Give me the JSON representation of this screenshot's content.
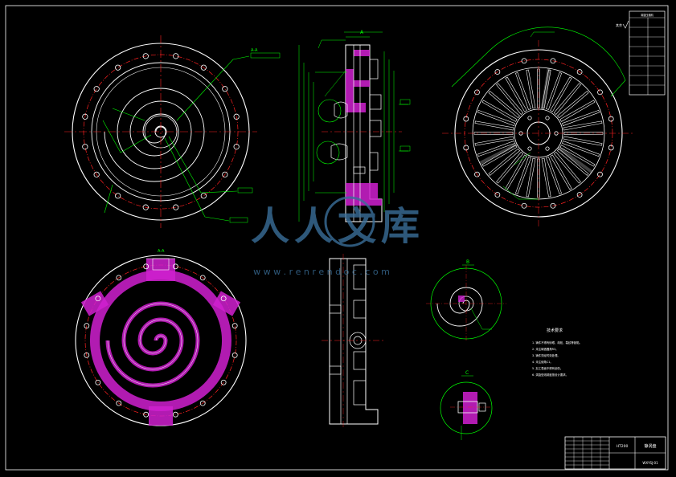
{
  "colors": {
    "background": "#000000",
    "outline": "#ffffff",
    "centerline": "#ff2020",
    "dimension": "#00ff00",
    "hatch": "#d020d0",
    "watermark": "#3a6f99"
  },
  "section_labels": {
    "top_left_view": "A-A",
    "side_view_top": "A",
    "bottom_left_section": "A-A",
    "detail_1": "B",
    "detail_2": "C"
  },
  "watermark": {
    "brand": "人人文库",
    "url": "w w w . r e n r e n d o c . c o m"
  },
  "notes": {
    "title": "技术要求",
    "lines": [
      "1. 铸件不得有砂眼、疏松、裂纹等缺陷。",
      "2. 未注铸造圆角R3。",
      "3. 铸件须经时效处理。",
      "4. 未注倒角C1。",
      "5. 加工表面不得有划伤。",
      "6. 涡旋型线精度按设计要求。"
    ]
  },
  "title_block": {
    "part_name": "静涡盘",
    "drawing_no": "WXYSJ-01",
    "material": "HT200"
  },
  "revision_table": {
    "header": "涡旋压缩机",
    "corner_text": "其余",
    "rows": [
      "",
      "",
      "",
      "",
      "",
      "",
      ""
    ]
  }
}
